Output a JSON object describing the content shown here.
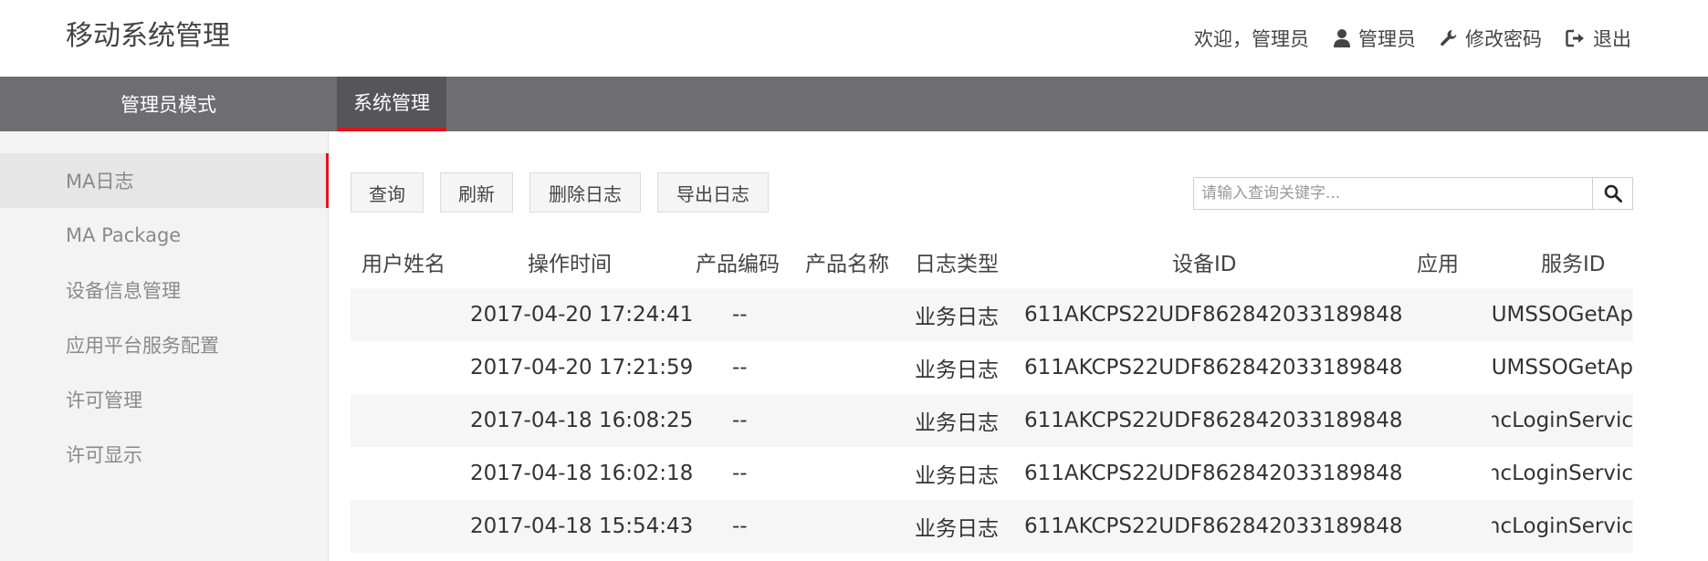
{
  "app_title": "移动系统管理",
  "header": {
    "welcome": "欢迎，管理员",
    "user_label": "管理员",
    "change_password_label": "修改密码",
    "logout_label": "退出"
  },
  "nav": {
    "mode_label": "管理员模式",
    "active_tab": "系统管理"
  },
  "sidebar": {
    "items": [
      {
        "label": "MA日志",
        "active": true
      },
      {
        "label": "MA Package"
      },
      {
        "label": "设备信息管理"
      },
      {
        "label": "应用平台服务配置"
      },
      {
        "label": "许可管理"
      },
      {
        "label": "许可显示"
      }
    ]
  },
  "toolbar": {
    "query_label": "查询",
    "refresh_label": "刷新",
    "delete_log_label": "删除日志",
    "export_log_label": "导出日志"
  },
  "search": {
    "placeholder": "请输入查询关键字...",
    "value": ""
  },
  "table": {
    "columns": [
      "用户姓名",
      "操作时间",
      "产品编码",
      "产品名称",
      "日志类型",
      "设备ID",
      "应用",
      "服务ID"
    ],
    "rows": [
      {
        "user": "",
        "time": "2017-04-20 17:24:41",
        "product_code": "--",
        "product_name": "",
        "log_type": "业务日志",
        "device_id": "611AKCPS22UDF862842033189848",
        "app": "",
        "service_id": "UMSSOGetAp"
      },
      {
        "user": "",
        "time": "2017-04-20 17:21:59",
        "product_code": "--",
        "product_name": "",
        "log_type": "业务日志",
        "device_id": "611AKCPS22UDF862842033189848",
        "app": "",
        "service_id": "UMSSOGetAp"
      },
      {
        "user": "",
        "time": "2017-04-18 16:08:25",
        "product_code": "--",
        "product_name": "",
        "log_type": "业务日志",
        "device_id": "611AKCPS22UDF862842033189848",
        "app": "",
        "service_id": "ncLoginServic"
      },
      {
        "user": "",
        "time": "2017-04-18 16:02:18",
        "product_code": "--",
        "product_name": "",
        "log_type": "业务日志",
        "device_id": "611AKCPS22UDF862842033189848",
        "app": "",
        "service_id": "ncLoginServic"
      },
      {
        "user": "",
        "time": "2017-04-18 15:54:43",
        "product_code": "--",
        "product_name": "",
        "log_type": "业务日志",
        "device_id": "611AKCPS22UDF862842033189848",
        "app": "",
        "service_id": "ncLoginServic"
      }
    ]
  },
  "colors": {
    "accent": "#e0141e",
    "navbar": "#6e6e72",
    "navbar_active": "#56565a"
  },
  "icons": [
    "user-icon",
    "wrench-icon",
    "logout-icon",
    "search-icon"
  ]
}
